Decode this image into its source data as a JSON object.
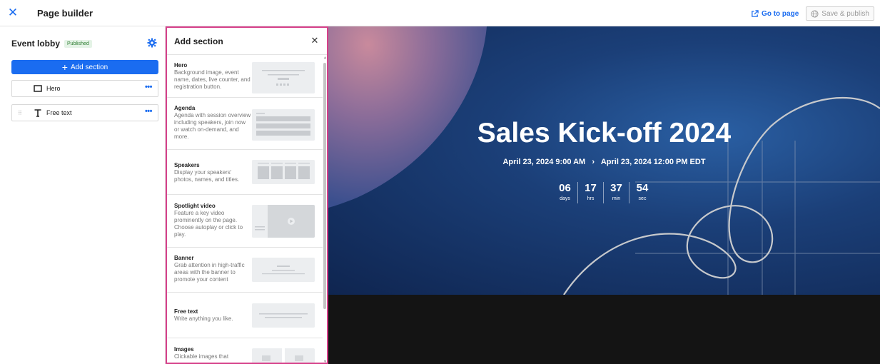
{
  "topbar": {
    "title": "Page builder",
    "goto_label": "Go to page",
    "save_label": "Save & publish"
  },
  "left": {
    "lobby_title": "Event lobby",
    "status_badge": "Published",
    "add_button": "Add section",
    "sections": [
      {
        "label": "Hero",
        "icon": "rectangle-icon"
      },
      {
        "label": "Free text",
        "icon": "text-icon"
      }
    ]
  },
  "add_panel": {
    "title": "Add section",
    "items": [
      {
        "name": "Hero",
        "desc": "Background image, event name, dates, live counter, and registration button."
      },
      {
        "name": "Agenda",
        "desc": "Agenda with session overview including speakers, join now or watch on-demand, and more."
      },
      {
        "name": "Speakers",
        "desc": "Display your speakers' photos, names, and titles."
      },
      {
        "name": "Spotlight video",
        "desc": "Feature a key video prominently on the page. Choose autoplay or click to play."
      },
      {
        "name": "Banner",
        "desc": "Grab attention in high-traffic areas with the banner to promote your content"
      },
      {
        "name": "Free text",
        "desc": "Write anything you like."
      },
      {
        "name": "Images",
        "desc": "Clickable images that"
      }
    ]
  },
  "preview": {
    "title": "Sales Kick-off 2024",
    "date_start": "April 23, 2024 9:00 AM",
    "date_sep": "›",
    "date_end": "April 23, 2024 12:00 PM EDT",
    "countdown": [
      {
        "value": "06",
        "unit": "days"
      },
      {
        "value": "17",
        "unit": "hrs"
      },
      {
        "value": "37",
        "unit": "min"
      },
      {
        "value": "54",
        "unit": "sec"
      }
    ]
  },
  "colors": {
    "accent": "#1a6cf0",
    "panel_highlight": "#d6408a",
    "hero_bg": "#1b3f78"
  }
}
